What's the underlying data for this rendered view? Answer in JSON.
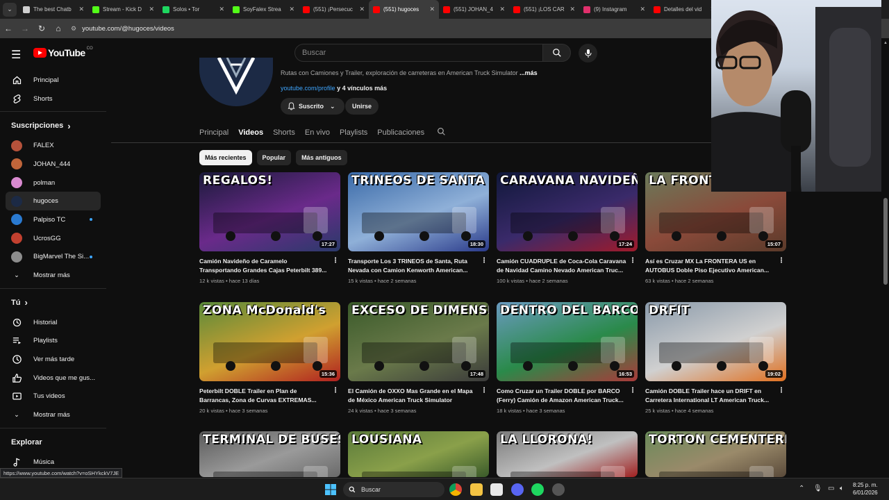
{
  "browser": {
    "tabs": [
      {
        "title": "The best Chatb",
        "color": "#cfcfcf"
      },
      {
        "title": "Stream - Kick D",
        "color": "#53fc18"
      },
      {
        "title": "Solos • Tor",
        "color": "#1ed760"
      },
      {
        "title": "SoyFalex Strea",
        "color": "#53fc18"
      },
      {
        "title": "(551) ¡Persecuc",
        "color": "#ff0000"
      },
      {
        "title": "(551) hugoces",
        "color": "#ff0000"
      },
      {
        "title": "(551) JOHAN_4",
        "color": "#ff0000"
      },
      {
        "title": "(551) ¡LOS CAR",
        "color": "#ff0000"
      },
      {
        "title": "(9) Instagram",
        "color": "#e1306c"
      },
      {
        "title": "Detalles del vid",
        "color": "#ff0000"
      }
    ],
    "active_tab": 5,
    "url": "youtube.com/@hugoces/videos",
    "status_url": "https://www.youtube.com/watch?v=oSHYkckV7JE"
  },
  "yt": {
    "logo_text": "YouTube",
    "logo_country": "CO",
    "search_placeholder": "Buscar"
  },
  "sidebar": {
    "main": [
      {
        "label": "Principal",
        "icon": "home-icon"
      },
      {
        "label": "Shorts",
        "icon": "shorts-icon"
      }
    ],
    "subs_heading": "Suscripciones",
    "subs": [
      {
        "label": "FALEX",
        "color": "#b5523b",
        "live": false
      },
      {
        "label": "JOHAN_444",
        "color": "#c0653a",
        "live": false
      },
      {
        "label": "polman",
        "color": "#d98ad0",
        "live": false
      },
      {
        "label": "hugoces",
        "color": "#1c2a45",
        "live": false
      },
      {
        "label": "Palpiso TC",
        "color": "#2a7ad1",
        "live": true
      },
      {
        "label": "UcrosGG",
        "color": "#c2402f",
        "live": false
      },
      {
        "label": "BigMarvel The Si...",
        "color": "#8d8d8d",
        "live": true
      }
    ],
    "subs_more": "Mostrar más",
    "you_heading": "Tú",
    "you": [
      {
        "label": "Historial",
        "icon": "history-icon"
      },
      {
        "label": "Playlists",
        "icon": "playlists-icon"
      },
      {
        "label": "Ver más tarde",
        "icon": "clock-icon"
      },
      {
        "label": "Videos que me gus...",
        "icon": "like-icon"
      },
      {
        "label": "Tus videos",
        "icon": "video-icon"
      }
    ],
    "you_more": "Mostrar más",
    "explore_heading": "Explorar",
    "explore": [
      {
        "label": "Música",
        "icon": "music-icon"
      }
    ]
  },
  "channel": {
    "description": "Rutas con Camiones y Trailer, exploración de carreteras en American Truck Simulator",
    "more": "...más",
    "link": "youtube.com/profile",
    "links_more": "y 4 vínculos más",
    "subscribed_label": "Suscrito",
    "join_label": "Unirse",
    "tabs": [
      "Principal",
      "Videos",
      "Shorts",
      "En vivo",
      "Playlists",
      "Publicaciones"
    ],
    "active_tab": "Videos"
  },
  "chips": [
    "Más recientes",
    "Popular",
    "Más antiguos"
  ],
  "videos": [
    {
      "thumb_text": "REGALOS!",
      "duration": "17:27",
      "title": "Camión Navideño de Caramelo Transportando Grandes Cajas Peterbilt 389...",
      "meta": "12 k vistas • hace 13 días",
      "bg": [
        "#1a1a3a",
        "#6a2a8a",
        "#2a3a6a"
      ]
    },
    {
      "thumb_text": "TRINEOS DE SANTA",
      "duration": "18:30",
      "title": "Transporte Los 3 TRINEOS de Santa, Ruta Nevada con Camion Kenworth American...",
      "meta": "15 k vistas • hace 2 semanas",
      "bg": [
        "#3a6aa8",
        "#8fb0d8",
        "#2a3a8a"
      ]
    },
    {
      "thumb_text": "CARAVANA NAVIDEÑA",
      "duration": "17:24",
      "title": "Camión CUADRUPLE de Coca-Cola Caravana de Navidad Camino Nevado American Truc...",
      "meta": "100 k vistas • hace 2 semanas",
      "bg": [
        "#10183a",
        "#3a2a6a",
        "#a01a2a"
      ]
    },
    {
      "thumb_text": "LA FRONTERA",
      "duration": "15:07",
      "title": "Así es Cruzar MX La FRONTERA US en AUTOBUS Doble Piso Ejecutivo American...",
      "meta": "63 k vistas • hace 2 semanas",
      "bg": [
        "#6a7a5a",
        "#8a4a3a",
        "#5a3a2a"
      ]
    },
    {
      "thumb_text": "ZONA McDonald's",
      "duration": "15:36",
      "title": "Peterbilt DOBLE Trailer en Plan de Barrancas, Zona de Curvas EXTREMAS...",
      "meta": "20 k vistas • hace 3 semanas",
      "bg": [
        "#5a8a3a",
        "#d0a030",
        "#b02020"
      ]
    },
    {
      "thumb_text": "EXCESO DE DIMENSION",
      "duration": "17:48",
      "title": "El Camión de OXXO Mas Grande en el Mapa de México American Truck Simulator",
      "meta": "24 k vistas • hace 3 semanas",
      "bg": [
        "#3a5a2a",
        "#6a7a4a",
        "#3a3a3a"
      ]
    },
    {
      "thumb_text": "DENTRO DEL BARCO",
      "duration": "16:53",
      "title": "Como Cruzar un Trailer DOBLE por BARCO (Ferry) Camión de Amazon American Truck...",
      "meta": "18 k vistas • hace 3 semanas",
      "bg": [
        "#6a9ac0",
        "#2a8a4a",
        "#aa3a3a"
      ]
    },
    {
      "thumb_text": "DRFIT",
      "duration": "19:02",
      "title": "Camión DOBLE Trailer hace un DRIFT en Carretera International LT American Truck...",
      "meta": "25 k vistas • hace 4 semanas",
      "bg": [
        "#8a9aaa",
        "#d0d0d0",
        "#e07020"
      ]
    },
    {
      "thumb_text": "TERMINAL DE BUSES",
      "duration": "",
      "title": "",
      "meta": "",
      "bg": [
        "#5a5a5a",
        "#9a9a9a",
        "#6a6a6a"
      ]
    },
    {
      "thumb_text": "LOUSIANA",
      "duration": "",
      "title": "",
      "meta": "",
      "bg": [
        "#5a7a3a",
        "#8aa04a",
        "#3a5a2a"
      ]
    },
    {
      "thumb_text": "LA LLORONA!",
      "duration": "",
      "title": "",
      "meta": "",
      "bg": [
        "#7a7a7a",
        "#c0c0c0",
        "#a02020"
      ]
    },
    {
      "thumb_text": "TORTON CEMENTERIO!",
      "duration": "",
      "title": "",
      "meta": "",
      "bg": [
        "#6a8a5a",
        "#9a8a6a",
        "#5a4a3a"
      ]
    }
  ],
  "taskbar": {
    "search": "Buscar",
    "time": "8:25 p. m.",
    "date": "6/01/2026"
  }
}
